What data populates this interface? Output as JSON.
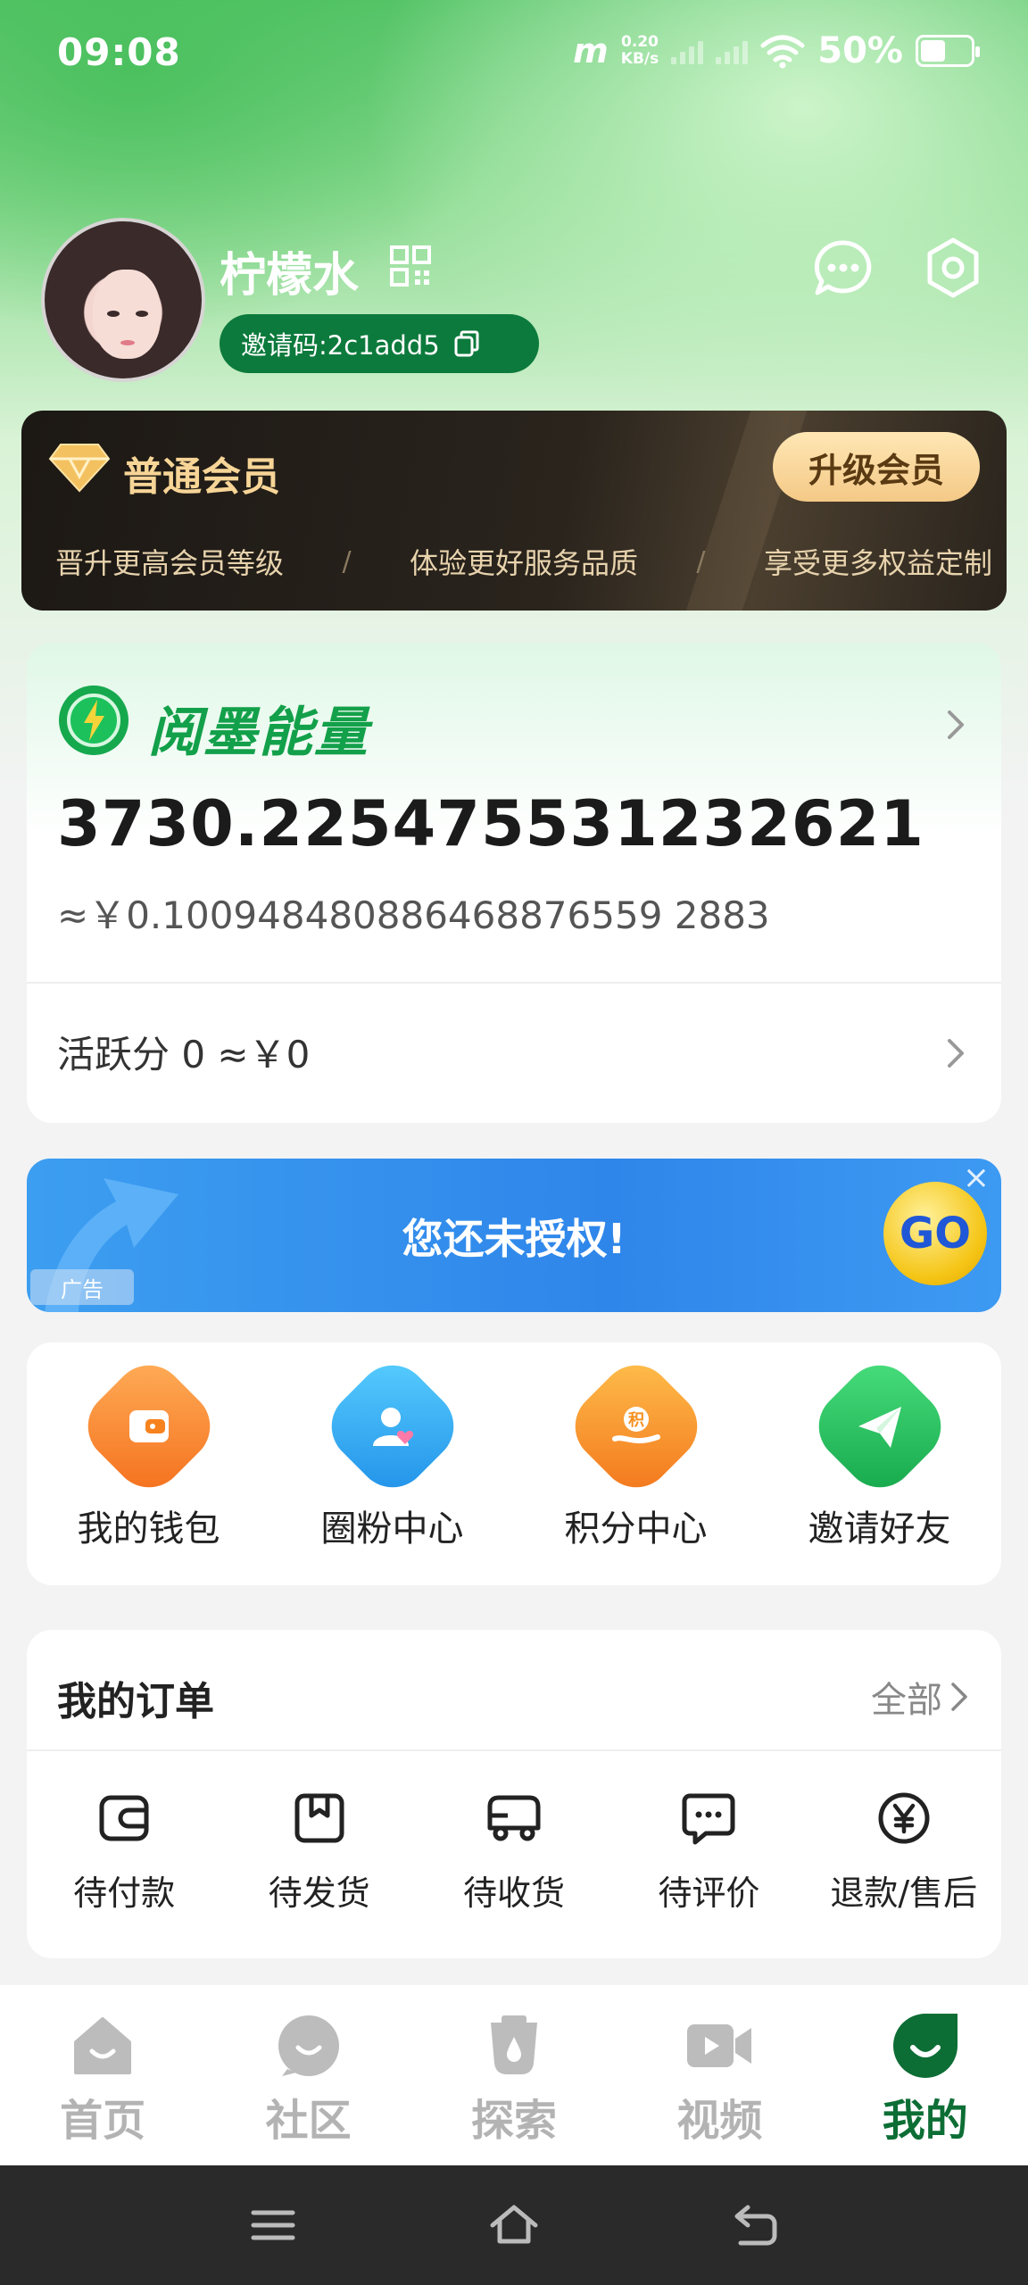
{
  "status_bar": {
    "time": "09:08",
    "net_speed_value": "0.20",
    "net_speed_unit": "KB/s",
    "battery": "50%"
  },
  "profile": {
    "username": "柠檬水",
    "invite_code": "邀请码:2c1add5"
  },
  "member": {
    "level": "普通会员",
    "upgrade_label": "升级会员",
    "perks": [
      "晋升更高会员等级",
      "体验更好服务品质",
      "享受更多权益定制"
    ],
    "separator": "/"
  },
  "energy": {
    "title": "阅墨能量",
    "value": "3730.225475531232621",
    "rmb_equiv": "≈￥0.100948480886468876559 2883",
    "active_score": "活跃分 0 ≈￥0"
  },
  "ad": {
    "text": "您还未授权!",
    "go": "GO",
    "label": "广告",
    "close": "×"
  },
  "quick_functions": [
    {
      "label": "我的钱包",
      "icon": "wallet-icon",
      "color": "#f7821e"
    },
    {
      "label": "圈粉中心",
      "icon": "fans-icon",
      "color": "#2ea4ef"
    },
    {
      "label": "积分中心",
      "icon": "points-icon",
      "color": "#f6901f"
    },
    {
      "label": "邀请好友",
      "icon": "send-icon",
      "color": "#26c25e"
    }
  ],
  "orders": {
    "title": "我的订单",
    "all": "全部",
    "items": [
      {
        "label": "待付款",
        "icon": "wallet-outline-icon"
      },
      {
        "label": "待发货",
        "icon": "box-icon"
      },
      {
        "label": "待收货",
        "icon": "truck-icon"
      },
      {
        "label": "待评价",
        "icon": "chat-icon"
      },
      {
        "label": "退款/售后",
        "icon": "yen-icon"
      }
    ]
  },
  "tabs": [
    {
      "label": "首页",
      "active": false
    },
    {
      "label": "社区",
      "active": false
    },
    {
      "label": "探索",
      "active": false
    },
    {
      "label": "视频",
      "active": false
    },
    {
      "label": "我的",
      "active": true
    }
  ],
  "colors": {
    "accent_green": "#0d6e35",
    "energy_green": "#13a04a",
    "gold": "#f7d597"
  }
}
